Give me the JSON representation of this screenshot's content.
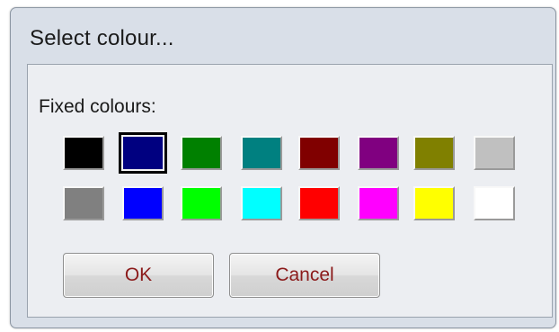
{
  "dialog": {
    "title": "Select colour..."
  },
  "group": {
    "label": "Fixed colours:"
  },
  "colors": [
    [
      "#000000",
      "#000080",
      "#008000",
      "#008080",
      "#800000",
      "#800080",
      "#808000",
      "#c0c0c0"
    ],
    [
      "#808080",
      "#0000ff",
      "#00ff00",
      "#00ffff",
      "#ff0000",
      "#ff00ff",
      "#ffff00",
      "#ffffff"
    ]
  ],
  "selected_color": "#000080",
  "buttons": {
    "ok_label": "OK",
    "cancel_label": "Cancel"
  }
}
